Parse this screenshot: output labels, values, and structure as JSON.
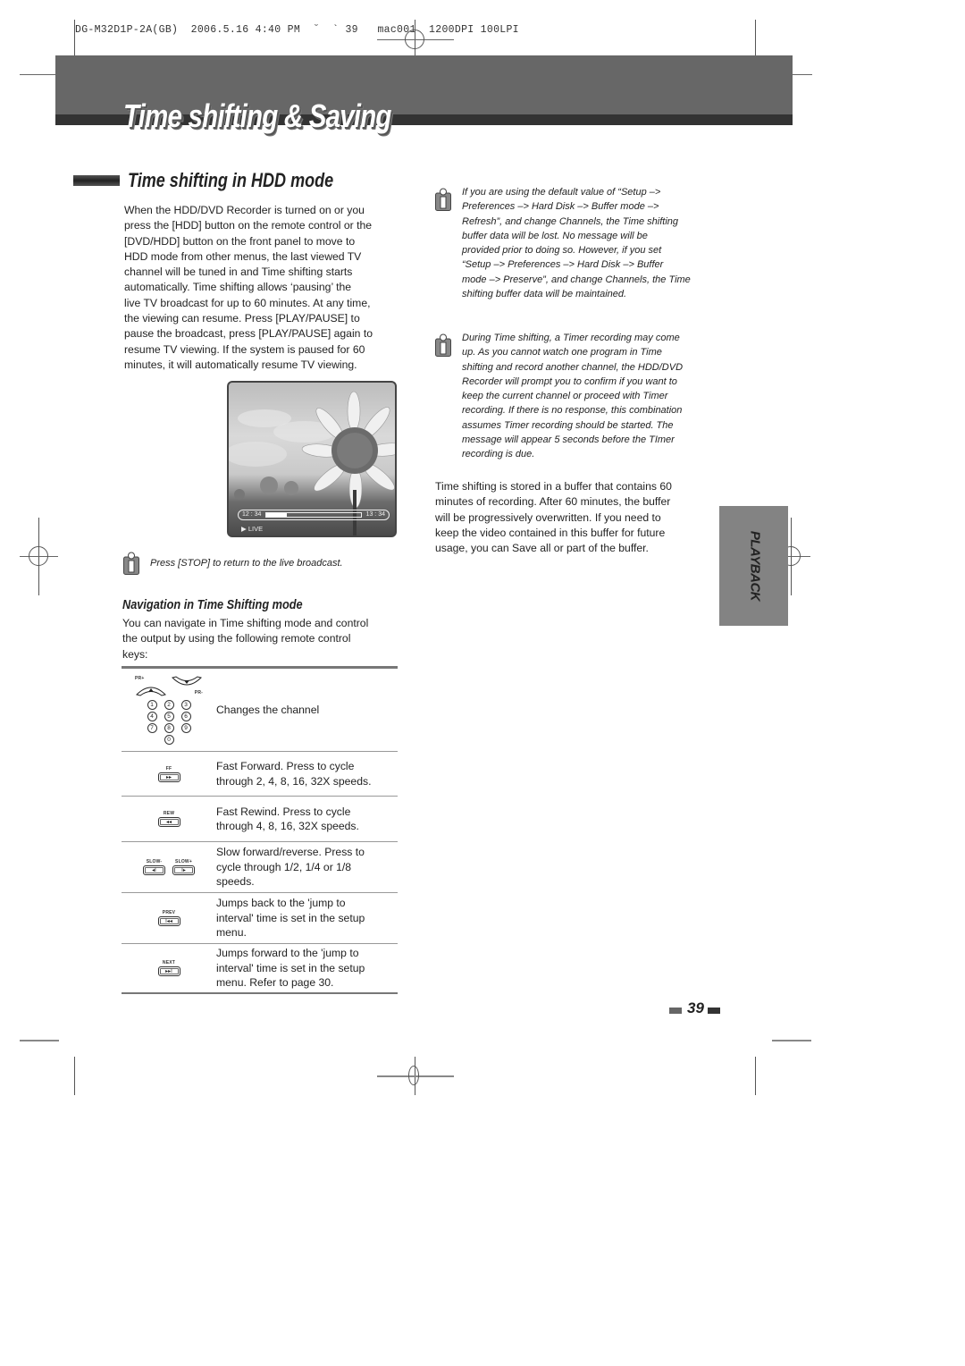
{
  "print_slug": "DG-M32D1P-2A(GB)  2006.5.16 4:40 PM  ˘  ` 39   mac001  1200DPI 100LPI",
  "page_title": "Time shifting & Saving",
  "section": {
    "title": "Time shifting in HDD mode",
    "intro_lines": [
      "When the HDD/DVD Recorder is turned on or you",
      "press the [HDD] button on the remote control or the",
      "[DVD/HDD] button on the front panel to move to",
      "HDD mode from other menus, the last viewed TV",
      "channel will be tuned in and Time shifting starts",
      "automatically. Time shifting allows ‘pausing’ the",
      "live TV broadcast for up to 60 minutes. At any time,",
      "the viewing can resume. Press [PLAY/PAUSE] to",
      "pause the broadcast, press [PLAY/PAUSE] again to",
      "resume TV viewing. If the system is paused for 60",
      "minutes, it will automatically resume TV viewing."
    ]
  },
  "screen_osd": {
    "start_time": "12 : 34",
    "end_time": "13 : 34",
    "progress_fraction": 0.22,
    "mode_label": "▶ LIVE"
  },
  "stop_note": "Press [STOP] to return to the live broadcast.",
  "navigation": {
    "title": "Navigation in Time Shifting mode",
    "intro_lines": [
      "You can navigate in Time shifting mode and control",
      "the output by using the following remote control",
      "keys:"
    ],
    "keys": [
      {
        "buttons": [
          "PR+",
          "PR-",
          "1",
          "2",
          "3",
          "4",
          "5",
          "6",
          "7",
          "8",
          "9",
          "0"
        ],
        "description_lines": [
          "Changes the channel"
        ]
      },
      {
        "buttons": [
          "FF"
        ],
        "glyph": "▸▸",
        "description_lines": [
          "Fast Forward. Press to cycle",
          "through 2, 4, 8, 16, 32X speeds."
        ]
      },
      {
        "buttons": [
          "REW"
        ],
        "glyph": "◂◂",
        "description_lines": [
          "Fast Rewind. Press to cycle",
          "through 4, 8, 16, 32X speeds."
        ]
      },
      {
        "buttons": [
          "SLOW-",
          "SLOW+"
        ],
        "glyphs": [
          "◂I",
          "I▸"
        ],
        "description_lines": [
          "Slow forward/reverse. Press to",
          "cycle through 1/2, 1/4 or 1/8",
          "speeds."
        ]
      },
      {
        "buttons": [
          "PREV"
        ],
        "glyph": "I◂◂",
        "description_lines": [
          "Jumps back to the 'jump to",
          "interval' time is set in the setup",
          "menu."
        ]
      },
      {
        "buttons": [
          "NEXT"
        ],
        "glyph": "▸▸I",
        "description_lines": [
          "Jumps forward to the 'jump to",
          "interval' time is set in the setup",
          "menu. Refer to page 30."
        ]
      }
    ]
  },
  "notes_right": [
    {
      "lines": [
        "If you are using the default value of “Setup –>",
        "Preferences –> Hard Disk  –> Buffer mode  –>",
        "Refresh”, and change Channels, the Time shifting",
        "buffer data will be lost. No message will be",
        "provided prior to doing so. However, if you set",
        "“Setup –> Preferences –> Hard Disk  –> Buffer",
        "mode  –> Preserve”, and change Channels, the Time",
        "shifting buffer data will be maintained."
      ]
    },
    {
      "lines": [
        "During Time shifting, a Timer recording may come",
        "up. As you cannot watch one program in Time",
        "shifting and record another channel, the HDD/DVD",
        "Recorder will prompt you to confirm if you want to",
        "keep the current channel or proceed with Timer",
        "recording. If there is no response, this combination",
        "assumes Timer recording should be started. The",
        "message will appear 5 seconds before the TImer",
        "recording is due."
      ]
    }
  ],
  "buffer_paragraph_lines": [
    "Time shifting is stored in a buffer that contains 60",
    "minutes of recording. After 60 minutes, the buffer",
    "will be progressively overwritten. If you need to",
    "keep the video contained in this buffer for future",
    "usage, you can Save all or part of the buffer."
  ],
  "side_tab": "PLAYBACK",
  "page_number": "39",
  "colors": {
    "header_band": "#676767",
    "header_band_dark": "#333333",
    "side_tab": "#838383"
  }
}
